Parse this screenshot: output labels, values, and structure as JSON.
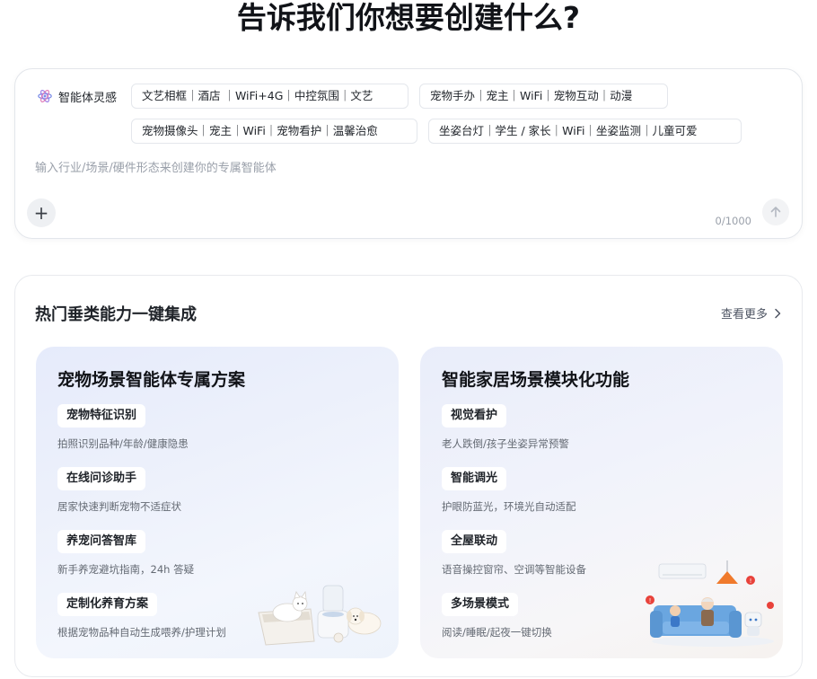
{
  "page": {
    "title": "告诉我们你想要创建什么?"
  },
  "prompt": {
    "inspiration_label": "智能体灵感",
    "chips": [
      "文艺相框｜酒店 ｜WiFi+4G｜中控氛围｜文艺",
      "宠物手办｜宠主｜WiFi｜宠物互动｜动漫",
      "宠物摄像头｜宠主｜WiFi｜宠物看护｜温馨治愈",
      "坐姿台灯｜学生 / 家长｜WiFi｜坐姿监测｜儿童可爱"
    ],
    "input_value": "",
    "placeholder": "输入行业/场景/硬件形态来创建你的专属智能体",
    "add_label": "+",
    "char_count": "0/1000",
    "send_icon": "arrow-up-icon"
  },
  "capabilities": {
    "title": "热门垂类能力一键集成",
    "see_more": "查看更多",
    "cards": [
      {
        "title": "宠物场景智能体专属方案",
        "items": [
          {
            "tag": "宠物特征识别",
            "desc": "拍照识别品种/年龄/健康隐患"
          },
          {
            "tag": "在线问诊助手",
            "desc": "居家快速判断宠物不适症状"
          },
          {
            "tag": "养宠问答智库",
            "desc": "新手养宠避坑指南，24h 答疑"
          },
          {
            "tag": "定制化养育方案",
            "desc": "根据宠物品种自动生成喂养/护理计划"
          }
        ]
      },
      {
        "title": "智能家居场景模块化功能",
        "items": [
          {
            "tag": "视觉看护",
            "desc": "老人跌倒/孩子坐姿异常预警"
          },
          {
            "tag": "智能调光",
            "desc": "护眼防蓝光，环境光自动适配"
          },
          {
            "tag": "全屋联动",
            "desc": "语音操控窗帘、空调等智能设备"
          },
          {
            "tag": "多场景模式",
            "desc": "阅读/睡眠/起夜一键切换"
          }
        ]
      }
    ]
  },
  "colors": {
    "accent_red": "#e8423b",
    "lamp_orange": "#f07a2c",
    "sofa_blue": "#6aa6e0"
  }
}
